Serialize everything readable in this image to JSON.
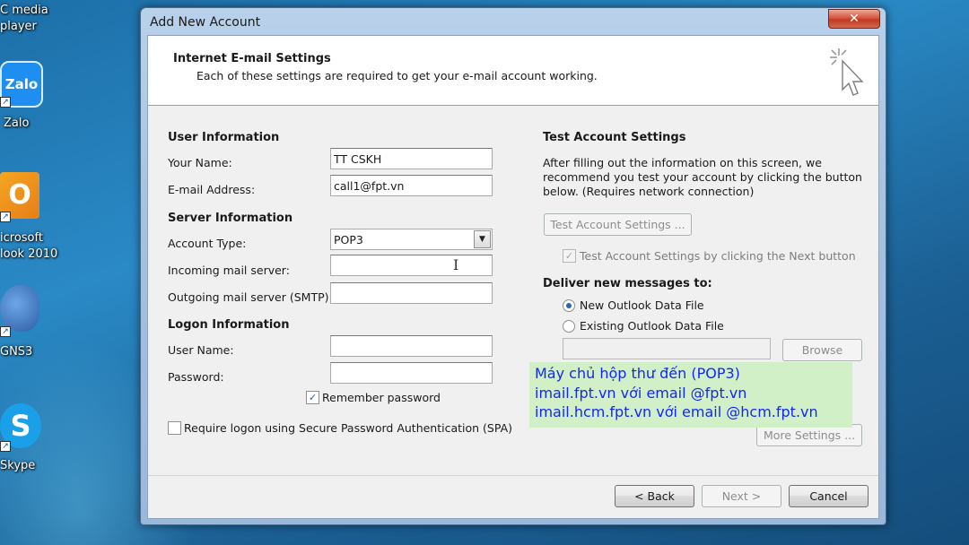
{
  "desktop": {
    "icons": [
      {
        "name": "vlc",
        "label_lines": [
          "C media",
          "player"
        ]
      },
      {
        "name": "zalo",
        "label_lines": [
          "Zalo"
        ],
        "tile_text": "Zalo"
      },
      {
        "name": "outlook",
        "label_lines": [
          "icrosoft",
          "look 2010"
        ],
        "tile_text": "O"
      },
      {
        "name": "gns3",
        "label_lines": [
          "GNS3"
        ]
      },
      {
        "name": "skype",
        "label_lines": [
          "Skype"
        ],
        "tile_text": "S"
      }
    ]
  },
  "window": {
    "title": "Add New Account",
    "close_glyph": "✕",
    "header": {
      "title": "Internet E-mail Settings",
      "subtitle": "Each of these settings are required to get your e-mail account working."
    },
    "user_info": {
      "title": "User Information",
      "your_name_label": "Your Name:",
      "your_name_value": "TT CSKH",
      "email_label": "E-mail Address:",
      "email_value": "call1@fpt.vn"
    },
    "server_info": {
      "title": "Server Information",
      "account_type_label": "Account Type:",
      "account_type_value": "POP3",
      "incoming_label": "Incoming mail server:",
      "incoming_value": "",
      "outgoing_label": "Outgoing mail server (SMTP):",
      "outgoing_value": ""
    },
    "logon_info": {
      "title": "Logon Information",
      "username_label": "User Name:",
      "username_value": "",
      "password_label": "Password:",
      "password_value": "",
      "remember_label": "Remember password",
      "remember_checked": true,
      "spa_label": "Require logon using Secure Password Authentication (SPA)",
      "spa_checked": false
    },
    "test_settings": {
      "title": "Test Account Settings",
      "description_lines": [
        "After filling out the information on this screen, we",
        "recommend you test your account by clicking the button",
        "below. (Requires network connection)"
      ],
      "test_button": "Test Account Settings ...",
      "test_next_label": "Test Account Settings by clicking the Next button",
      "test_next_checked": true
    },
    "deliver": {
      "title": "Deliver new messages to:",
      "option_new": "New Outlook Data File",
      "option_existing": "Existing Outlook Data File",
      "selected": "new",
      "existing_path": "",
      "browse_button": "Browse"
    },
    "more_settings_button": "More Settings ...",
    "footer": {
      "back": "< Back",
      "next": "Next >",
      "cancel": "Cancel"
    }
  },
  "annotation": {
    "lines": [
      "Máy chủ hộp thư đến (POP3)",
      " imail.fpt.vn với email @fpt.vn",
      " imail.hcm.fpt.vn với email @hcm.fpt.vn"
    ],
    "bg_color": "#d0f0c6",
    "text_color": "#0a1cff"
  }
}
